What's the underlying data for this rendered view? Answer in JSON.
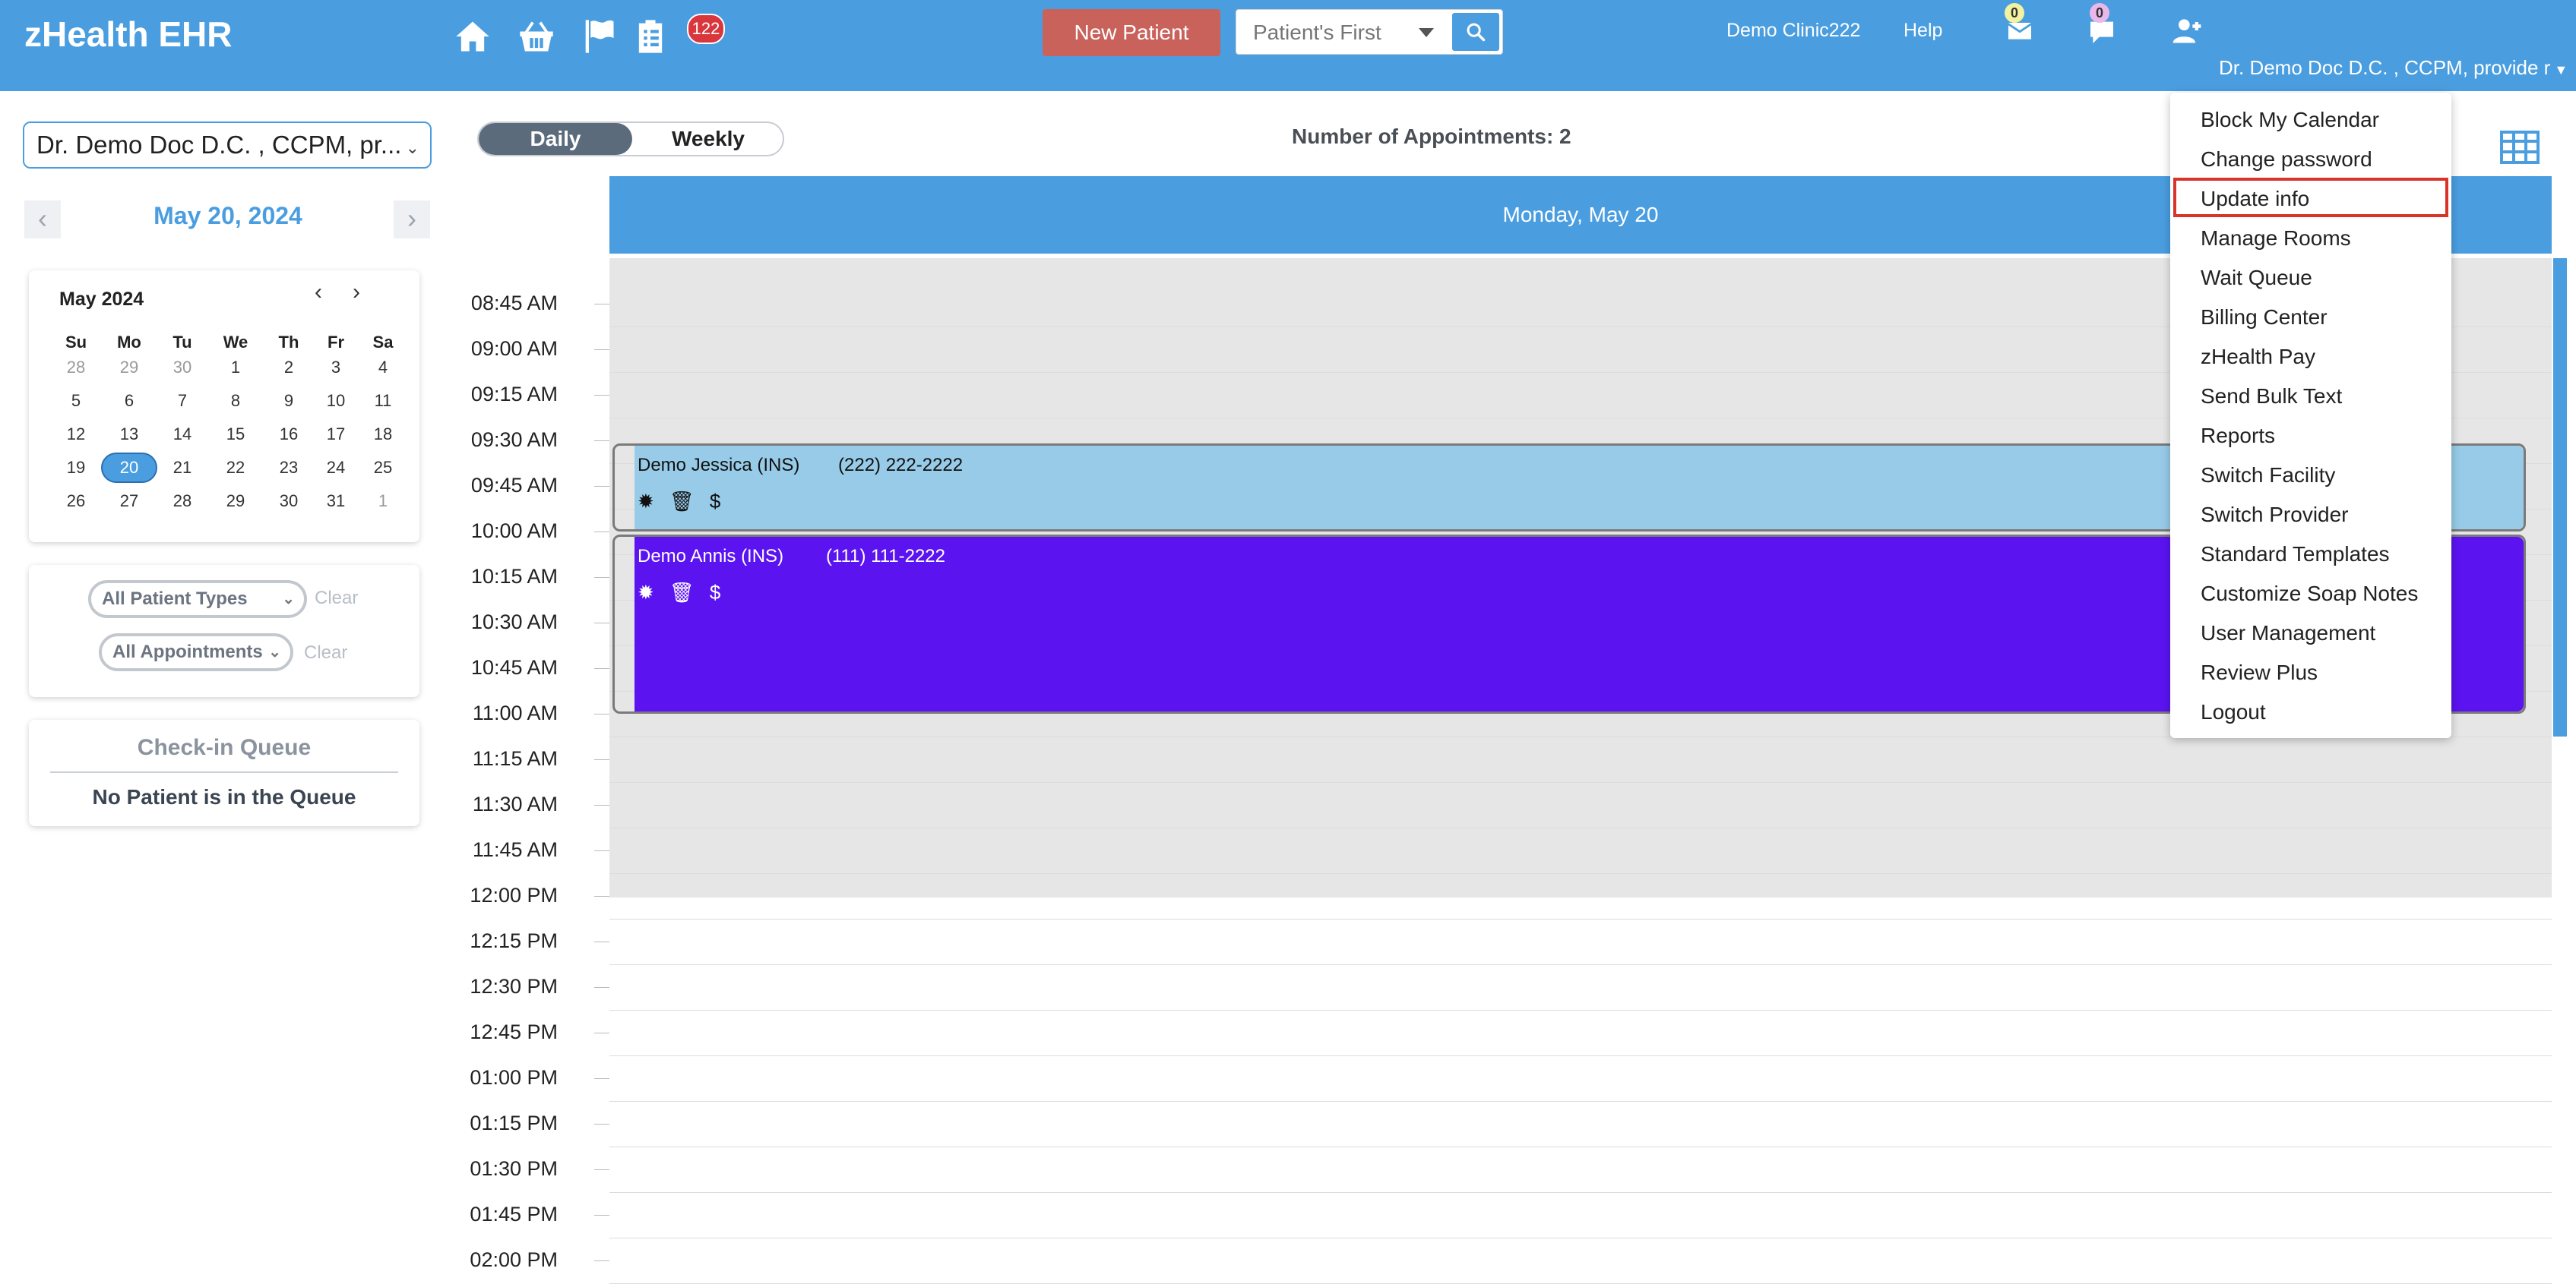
{
  "header": {
    "brand": "zHealth EHR",
    "icons": [
      "home-icon",
      "basket-icon",
      "flag-icon",
      "clipboard-icon"
    ],
    "tasks_badge": "122",
    "new_patient_label": "New Patient",
    "search_placeholder": "Patient's First",
    "clinic_name": "Demo Clinic222",
    "help_label": "Help",
    "mail_count": "0",
    "chat_count": "0",
    "user_label": "Dr. Demo Doc D.C. , CCPM, provide r",
    "colors": {
      "bar": "#4a9ee0",
      "new_patient": "#c9625b"
    }
  },
  "sidebar": {
    "provider_select": "Dr. Demo Doc D.C. , CCPM, pr...",
    "date_label": "May 20, 2024",
    "prev_label": "‹",
    "next_label": "›",
    "calendar": {
      "title": "May 2024",
      "prev": "‹",
      "next": "›",
      "weekdays": [
        "Su",
        "Mo",
        "Tu",
        "We",
        "Th",
        "Fr",
        "Sa"
      ],
      "weeks": [
        [
          "28",
          "29",
          "30",
          "1",
          "2",
          "3",
          "4"
        ],
        [
          "5",
          "6",
          "7",
          "8",
          "9",
          "10",
          "11"
        ],
        [
          "12",
          "13",
          "14",
          "15",
          "16",
          "17",
          "18"
        ],
        [
          "19",
          "20",
          "21",
          "22",
          "23",
          "24",
          "25"
        ],
        [
          "26",
          "27",
          "28",
          "29",
          "30",
          "31",
          "1"
        ]
      ],
      "selected": "20"
    },
    "filters": {
      "patient_types": "All Patient Types",
      "appointments": "All Appointments",
      "clear_label": "Clear"
    },
    "queue": {
      "title": "Check-in Queue",
      "empty_text": "No Patient is in the Queue"
    }
  },
  "main": {
    "tab_daily": "Daily",
    "tab_weekly": "Weekly",
    "appointments_count": "Number of Appointments: 2",
    "day_header": "Monday, May 20",
    "times": [
      "08:45 AM",
      "09:00 AM",
      "09:15 AM",
      "09:30 AM",
      "09:45 AM",
      "10:00 AM",
      "10:15 AM",
      "10:30 AM",
      "10:45 AM",
      "11:00 AM",
      "11:15 AM",
      "11:30 AM",
      "11:45 AM",
      "12:00 PM",
      "12:15 PM",
      "12:30 PM",
      "12:45 PM",
      "01:00 PM",
      "01:15 PM",
      "01:30 PM",
      "01:45 PM",
      "02:00 PM"
    ],
    "appointments": [
      {
        "name": "Demo Jessica (INS)",
        "phone": "(222) 222-2222",
        "color": "#97cbe8",
        "text_color": "#111111"
      },
      {
        "name": "Demo Annis (INS)",
        "phone": "(111) 111-2222",
        "color": "#5b13f0",
        "text_color": "#ffffff"
      }
    ],
    "appt_icons": {
      "gear": "✹",
      "trash": "🗑",
      "billing": "$"
    }
  },
  "user_menu": {
    "items": [
      "Block My Calendar",
      "Change password",
      "Update info",
      "Manage Rooms",
      "Wait Queue",
      "Billing Center",
      "zHealth Pay",
      "Send Bulk Text",
      "Reports",
      "Switch Facility",
      "Switch Provider",
      "Standard Templates",
      "Customize Soap Notes",
      "User Management",
      "Review Plus",
      "Logout"
    ],
    "highlighted": "Update info"
  }
}
